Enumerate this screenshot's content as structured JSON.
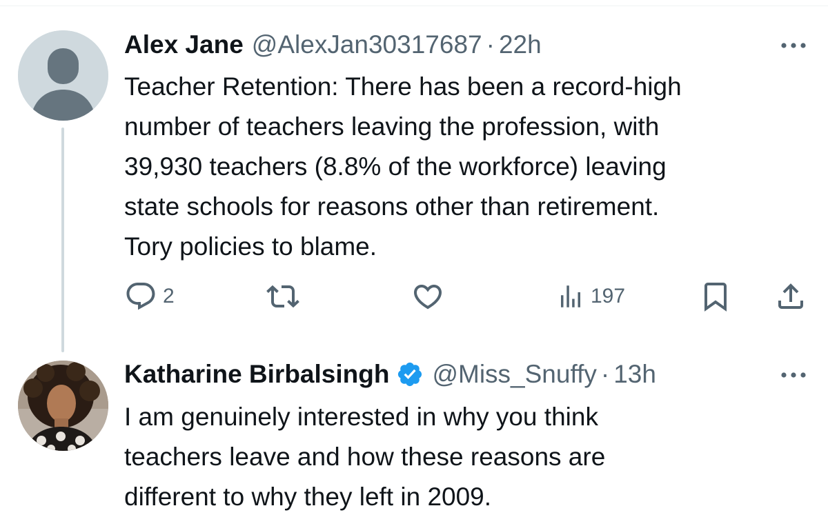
{
  "tweets": [
    {
      "author_name": "Alex Jane",
      "handle": "@AlexJan30317687",
      "separator": "·",
      "time": "22h",
      "verified": false,
      "avatar": "default-avatar",
      "body_lines": [
        "Teacher Retention: There has been a record-high",
        "number of teachers leaving the profession, with",
        "39,930 teachers (8.8% of the workforce) leaving",
        "state schools for reasons other than retirement.",
        "Tory policies to blame."
      ],
      "actions": {
        "replies": "2",
        "views": "197"
      }
    },
    {
      "author_name": "Katharine Birbalsingh",
      "handle": "@Miss_Snuffy",
      "separator": "·",
      "time": "13h",
      "verified": true,
      "avatar": "profile-photo",
      "body_lines": [
        "I am genuinely interested in why you think",
        "teachers leave and how these reasons are",
        "different to why they left in 2009."
      ]
    }
  ],
  "icons": {
    "reply": "reply-icon",
    "retweet": "retweet-icon",
    "like": "heart-icon",
    "views": "views-icon",
    "bookmark": "bookmark-icon",
    "share": "share-icon",
    "more": "more-icon",
    "verified": "verified-badge-icon"
  },
  "colors": {
    "text_primary": "#0f1419",
    "text_secondary": "#536471",
    "verified_blue": "#1d9bf0",
    "thread_line": "#cfd9de"
  }
}
